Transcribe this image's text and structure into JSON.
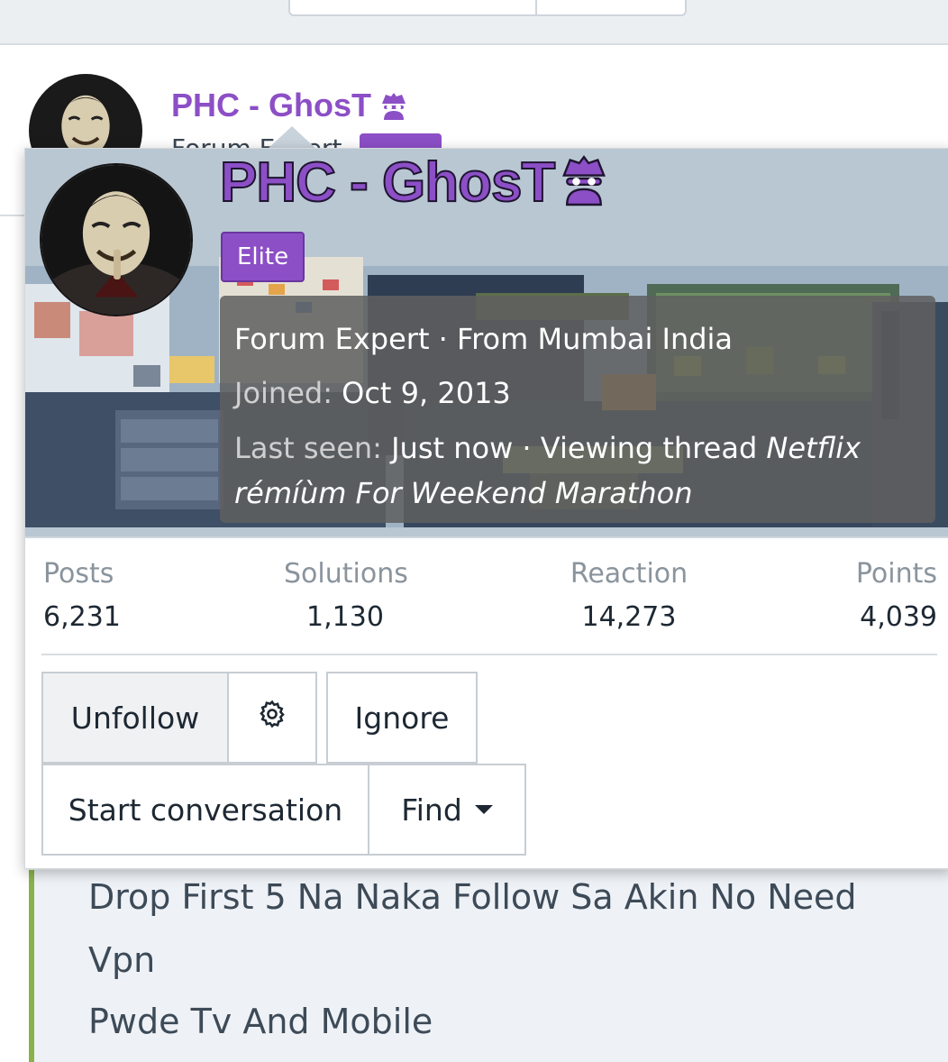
{
  "post": {
    "username": "PHC - GhosT",
    "fragment": "Forum Expert"
  },
  "tooltip": {
    "username": "PHC - GhosT",
    "role": "Elite",
    "title_line": "Forum Expert · From Mumbai India",
    "joined_label": "Joined:",
    "joined_value": "Oct 9, 2013",
    "last_seen_label": "Last seen:",
    "last_seen_value": "Just now · Viewing thread",
    "last_seen_thread": "Netflix rémíùm For Weekend Marathon",
    "stats": [
      {
        "label": "Posts",
        "value": "6,231"
      },
      {
        "label": "Solutions",
        "value": "1,130"
      },
      {
        "label": "Reaction",
        "value": "14,273"
      },
      {
        "label": "Points",
        "value": "4,039"
      }
    ],
    "buttons": {
      "unfollow": "Unfollow",
      "ignore": "Ignore",
      "start_conversation": "Start conversation",
      "find": "Find"
    }
  },
  "quote": {
    "lines": [
      "Drop First 5 Na Naka Follow Sa Akin No Need",
      "Vpn",
      "Pwde Tv And Mobile"
    ]
  },
  "colors": {
    "accent": "#8c4fc6",
    "quote_border": "#8bb24a"
  }
}
